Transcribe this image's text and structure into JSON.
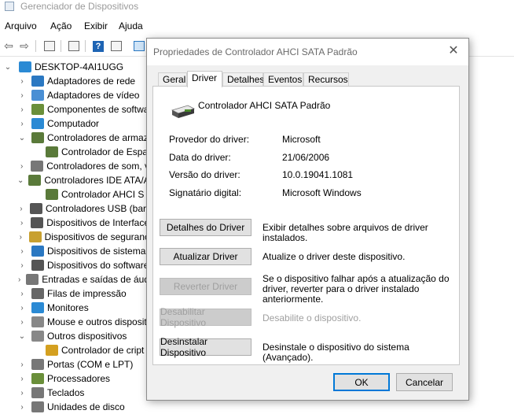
{
  "window": {
    "title": "Gerenciador de Dispositivos"
  },
  "menu": [
    "Arquivo",
    "Ação",
    "Exibir",
    "Ajuda"
  ],
  "tree": {
    "root": "DESKTOP-4AI1UGG",
    "items": [
      {
        "label": "Adaptadores de rede",
        "level": 1,
        "chev": "›",
        "color": "#2b78c2"
      },
      {
        "label": "Adaptadores de vídeo",
        "level": 1,
        "chev": "›",
        "color": "#4a8fd4"
      },
      {
        "label": "Componentes de softwa",
        "level": 1,
        "chev": "›",
        "color": "#6a8f3a"
      },
      {
        "label": "Computador",
        "level": 1,
        "chev": "›",
        "color": "#2b8ad4"
      },
      {
        "label": "Controladores de armaz",
        "level": 1,
        "chev": "⌄",
        "color": "#5a7a3a"
      },
      {
        "label": "Controlador de Espa",
        "level": 2,
        "chev": "",
        "color": "#5a7a3a"
      },
      {
        "label": "Controladores de som, v",
        "level": 1,
        "chev": "›",
        "color": "#777777"
      },
      {
        "label": "Controladores IDE ATA/A",
        "level": 1,
        "chev": "⌄",
        "color": "#5a7a3a"
      },
      {
        "label": "Controlador AHCI S",
        "level": 2,
        "chev": "",
        "color": "#5a7a3a"
      },
      {
        "label": "Controladores USB (barr",
        "level": 1,
        "chev": "›",
        "color": "#555555"
      },
      {
        "label": "Dispositivos de Interface",
        "level": 1,
        "chev": "›",
        "color": "#555555"
      },
      {
        "label": "Dispositivos de seguranç",
        "level": 1,
        "chev": "›",
        "color": "#c8a030"
      },
      {
        "label": "Dispositivos de sistema",
        "level": 1,
        "chev": "›",
        "color": "#2b78c2"
      },
      {
        "label": "Dispositivos do software",
        "level": 1,
        "chev": "›",
        "color": "#555555"
      },
      {
        "label": "Entradas e saídas de áud",
        "level": 1,
        "chev": "›",
        "color": "#777777"
      },
      {
        "label": "Filas de impressão",
        "level": 1,
        "chev": "›",
        "color": "#666666"
      },
      {
        "label": "Monitores",
        "level": 1,
        "chev": "›",
        "color": "#2b8ad4"
      },
      {
        "label": "Mouse e outros dispositi",
        "level": 1,
        "chev": "›",
        "color": "#888888"
      },
      {
        "label": "Outros dispositivos",
        "level": 1,
        "chev": "⌄",
        "color": "#888888"
      },
      {
        "label": "Controlador de cript",
        "level": 2,
        "chev": "",
        "color": "#d4a020"
      },
      {
        "label": "Portas (COM e LPT)",
        "level": 1,
        "chev": "›",
        "color": "#777777"
      },
      {
        "label": "Processadores",
        "level": 1,
        "chev": "›",
        "color": "#6a8f3a"
      },
      {
        "label": "Teclados",
        "level": 1,
        "chev": "›",
        "color": "#777777"
      },
      {
        "label": "Unidades de disco",
        "level": 1,
        "chev": "›",
        "color": "#777777"
      }
    ]
  },
  "dialog": {
    "title": "Propriedades de Controlador AHCI SATA Padrão",
    "tabs": [
      "Geral",
      "Driver",
      "Detalhes",
      "Eventos",
      "Recursos"
    ],
    "active_tab": "Driver",
    "device_name": "Controlador AHCI SATA Padrão",
    "props": [
      {
        "label": "Provedor do driver:",
        "value": "Microsoft"
      },
      {
        "label": "Data do driver:",
        "value": "21/06/2006"
      },
      {
        "label": "Versão do driver:",
        "value": "10.0.19041.1081"
      },
      {
        "label": "Signatário digital:",
        "value": "Microsoft Windows"
      }
    ],
    "actions": [
      {
        "label": "Detalhes do Driver",
        "desc": "Exibir detalhes sobre arquivos de driver instalados.",
        "enabled": true
      },
      {
        "label": "Atualizar Driver",
        "desc": "Atualize o driver deste dispositivo.",
        "enabled": true
      },
      {
        "label": "Reverter Driver",
        "desc": "Se o dispositivo falhar após a atualização do driver, reverter para o driver instalado anteriormente.",
        "enabled": false
      },
      {
        "label": "Desabilitar Dispositivo",
        "desc": "Desabilite o dispositivo.",
        "enabled": false
      },
      {
        "label": "Desinstalar Dispositivo",
        "desc": "Desinstale o dispositivo do sistema (Avançado).",
        "enabled": true
      }
    ],
    "ok": "OK",
    "cancel": "Cancelar"
  }
}
